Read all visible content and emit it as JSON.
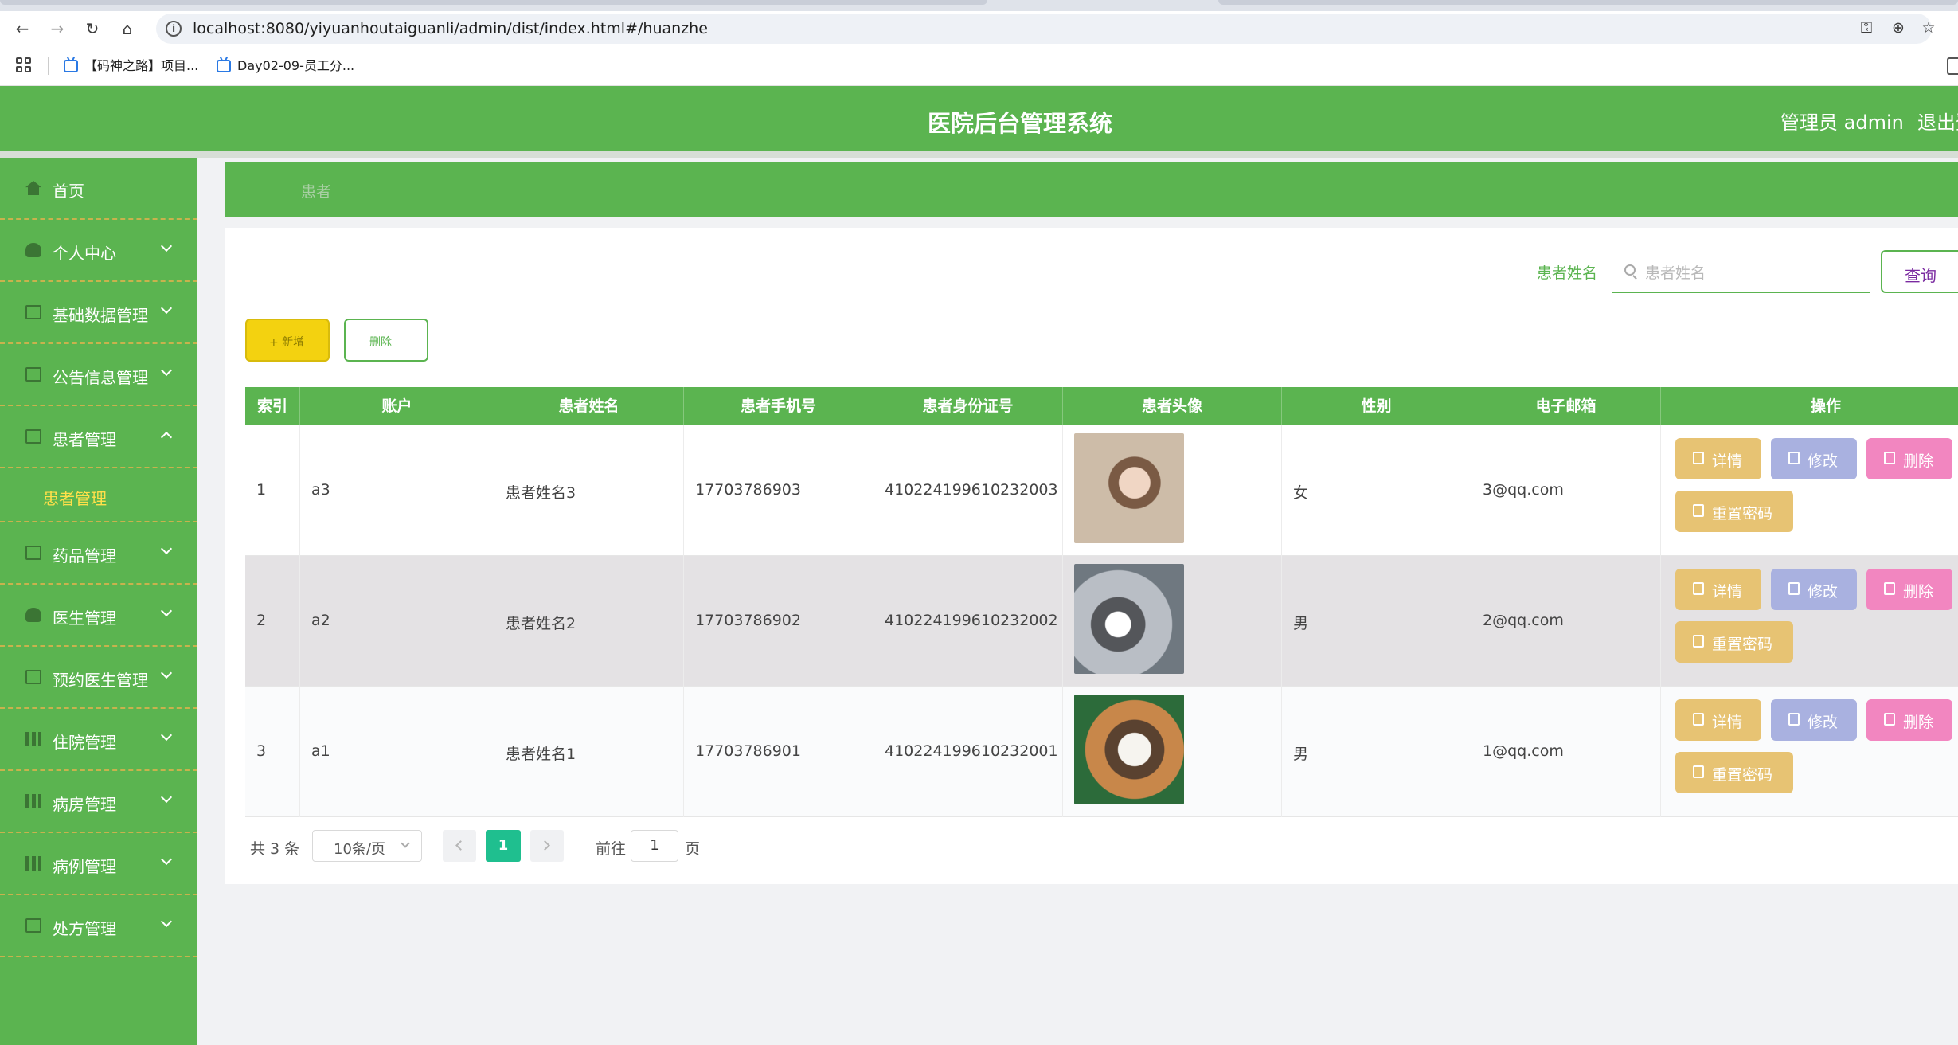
{
  "browser": {
    "url": "localhost:8080/yiyuanhoutaiguanli/admin/dist/index.html#/huanzhe",
    "bookmarks": [
      "【码神之路】项目...",
      "Day02-09-员工分..."
    ]
  },
  "header": {
    "title": "医院后台管理系统",
    "user": "管理员 admin",
    "logout": "退出登"
  },
  "sidebar": {
    "items": [
      {
        "label": "首页",
        "icon": "home-icon"
      },
      {
        "label": "个人中心",
        "icon": "user-icon"
      },
      {
        "label": "基础数据管理",
        "icon": "data-icon"
      },
      {
        "label": "公告信息管理",
        "icon": "notice-icon"
      },
      {
        "label": "患者管理",
        "icon": "patient-icon",
        "expanded": true
      },
      {
        "label": "药品管理",
        "icon": "medicine-icon"
      },
      {
        "label": "医生管理",
        "icon": "doctor-icon"
      },
      {
        "label": "预约医生管理",
        "icon": "appointment-icon"
      },
      {
        "label": "住院管理",
        "icon": "hospitalization-icon"
      },
      {
        "label": "病房管理",
        "icon": "ward-icon"
      },
      {
        "label": "病例管理",
        "icon": "case-icon"
      },
      {
        "label": "处方管理",
        "icon": "prescription-icon"
      }
    ],
    "sub_items": [
      {
        "label": "患者管理"
      }
    ]
  },
  "breadcrumb": {
    "current": "患者"
  },
  "search": {
    "label": "患者姓名",
    "placeholder": "患者姓名",
    "button": "查询"
  },
  "actions": {
    "add": "+ 新增",
    "delete": "删除"
  },
  "table": {
    "headers": [
      "索引",
      "账户",
      "患者姓名",
      "患者手机号",
      "患者身份证号",
      "患者头像",
      "性别",
      "电子邮箱",
      "操作"
    ],
    "rows": [
      {
        "index": "1",
        "account": "a3",
        "name": "患者姓名3",
        "phone": "17703786903",
        "id_card": "410224199610232003",
        "gender": "女",
        "email": "3@qq.com"
      },
      {
        "index": "2",
        "account": "a2",
        "name": "患者姓名2",
        "phone": "17703786902",
        "id_card": "410224199610232002",
        "gender": "男",
        "email": "2@qq.com"
      },
      {
        "index": "3",
        "account": "a1",
        "name": "患者姓名1",
        "phone": "17703786901",
        "id_card": "410224199610232001",
        "gender": "男",
        "email": "1@qq.com"
      }
    ],
    "row_actions": {
      "detail": "详情",
      "edit": "修改",
      "delete": "删除",
      "reset": "重置密码"
    }
  },
  "pagination": {
    "total": "共 3 条",
    "page_size": "10条/页",
    "current_page": "1",
    "goto_label": "前往",
    "goto_value": "1",
    "goto_unit": "页"
  },
  "colors": {
    "primary": "#5bb450",
    "add_button": "#f3d210",
    "detail": "#e7c373",
    "edit": "#a9b1e0",
    "delete": "#f286c0",
    "page_active": "#1fbf8f"
  }
}
